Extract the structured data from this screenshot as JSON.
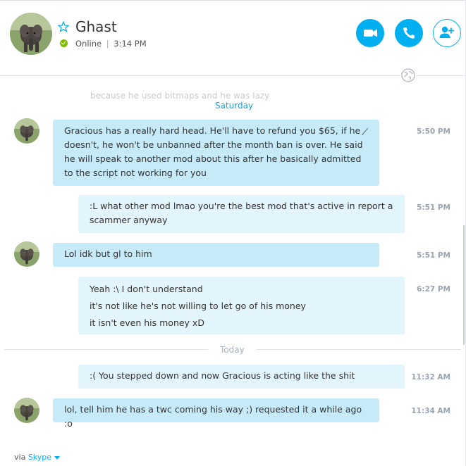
{
  "contact": {
    "name": "Ghast",
    "status": "Online",
    "time": "3:14 PM",
    "status_separator": "|"
  },
  "colors": {
    "accent": "#00aff0",
    "presence": "#7fba00",
    "bubble_them": "#c7eaf9",
    "bubble_me": "#e2f4fc"
  },
  "header_actions": [
    {
      "name": "video-call-button",
      "icon": "video-camera-icon"
    },
    {
      "name": "voice-call-button",
      "icon": "phone-icon"
    },
    {
      "name": "add-person-button",
      "icon": "add-person-icon"
    }
  ],
  "faded_text": "because he used bitmaps and he was lazy",
  "days": {
    "saturday": "Saturday",
    "today": "Today"
  },
  "messages": [
    {
      "from": "them",
      "lines": [
        "Gracious has a really hard head. He'll have to refund you $65, if he doesn't, he won't be unbanned after the month ban is over. He said he will speak to another mod about this after he basically admitted to the script not working for you"
      ],
      "time": "5:50 PM",
      "edited": true
    },
    {
      "from": "me",
      "lines": [
        ":L what other mod lmao you're the best mod that's active in report a scammer anyway"
      ],
      "time": "5:51 PM"
    },
    {
      "from": "them",
      "lines": [
        "Lol idk but gl to him"
      ],
      "time": "5:51 PM"
    },
    {
      "from": "me",
      "lines": [
        "Yeah :\\ I don't understand",
        "it's not like he's not willing to let go of his money",
        "it isn't even his money xD"
      ],
      "time": "6:27 PM"
    },
    {
      "from": "me",
      "lines": [
        ":( You stepped down and now Gracious is acting like the shit"
      ],
      "time": "11:32 AM"
    },
    {
      "from": "them",
      "lines": [
        "lol, tell him he has a twc coming his way ;) requested it a while ago :o"
      ],
      "time": "11:34 AM"
    }
  ],
  "footer": {
    "prefix": "via",
    "service": "Skype"
  }
}
